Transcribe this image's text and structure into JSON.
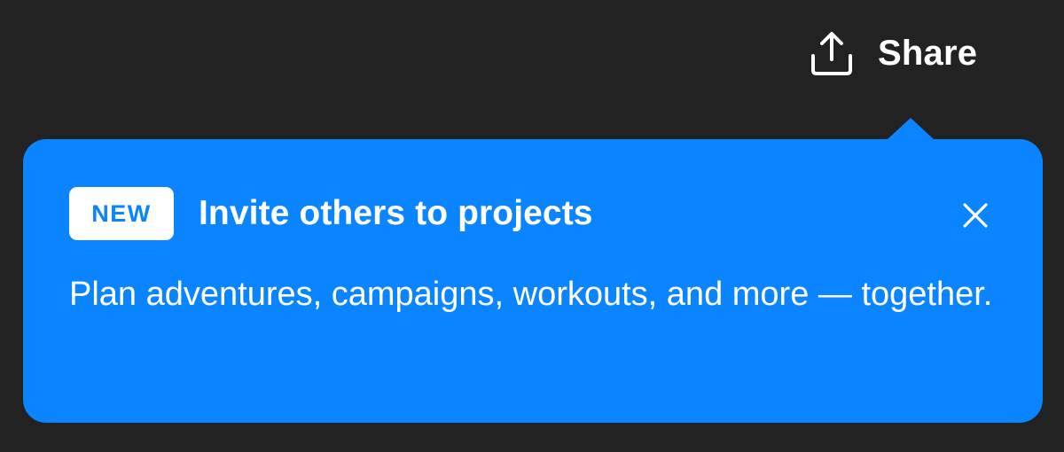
{
  "share": {
    "label": "Share",
    "icon": "share-upload-icon"
  },
  "popover": {
    "badge": "NEW",
    "title": "Invite others to projects",
    "body": "Plan adventures, campaigns, workouts, and more — together.",
    "close_icon": "close-icon"
  },
  "colors": {
    "background": "#222222",
    "popover": "#0a84ff",
    "text": "#ffffff",
    "badge_text": "#0a84ff"
  }
}
